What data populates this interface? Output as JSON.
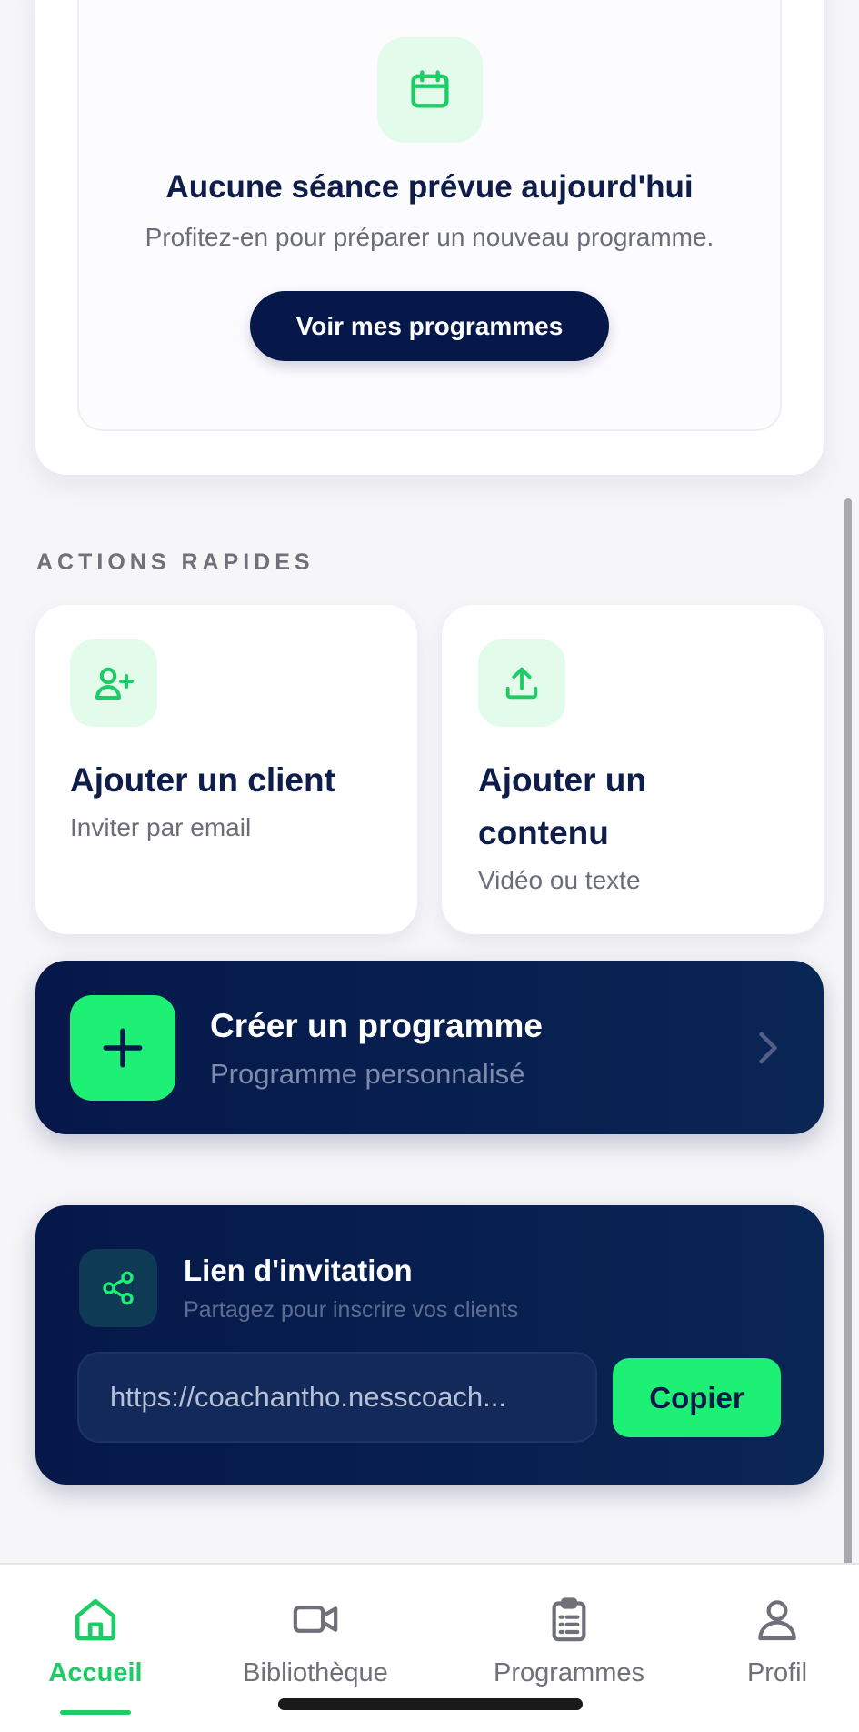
{
  "empty_state": {
    "icon": "calendar-icon",
    "title": "Aucune séance prévue aujourd'hui",
    "subtitle": "Profitez-en pour préparer un nouveau programme.",
    "button_label": "Voir mes programmes"
  },
  "quick_actions": {
    "section_label": "ACTIONS RAPIDES",
    "items": [
      {
        "icon": "user-plus-icon",
        "title": "Ajouter un client",
        "subtitle": "Inviter par email"
      },
      {
        "icon": "upload-icon",
        "title_line1": "Ajouter un",
        "title_line2": "contenu",
        "subtitle": "Vidéo ou texte"
      }
    ]
  },
  "create_program": {
    "icon": "plus-icon",
    "title": "Créer un programme",
    "subtitle": "Programme personnalisé"
  },
  "invite": {
    "icon": "share-icon",
    "title": "Lien d'invitation",
    "subtitle": "Partagez pour inscrire vos clients",
    "link_value": "https://coachantho.nesscoach...",
    "copy_label": "Copier"
  },
  "bottom_nav": {
    "items": [
      {
        "icon": "home-icon",
        "label": "Accueil",
        "active": true
      },
      {
        "icon": "video-icon",
        "label": "Bibliothèque",
        "active": false
      },
      {
        "icon": "clipboard-icon",
        "label": "Programmes",
        "active": false
      },
      {
        "icon": "user-icon",
        "label": "Profil",
        "active": false
      }
    ]
  },
  "colors": {
    "accent": "#1df074",
    "accent_text": "#1ecc66",
    "navy": "#06184a",
    "background": "#f6f5f8"
  }
}
